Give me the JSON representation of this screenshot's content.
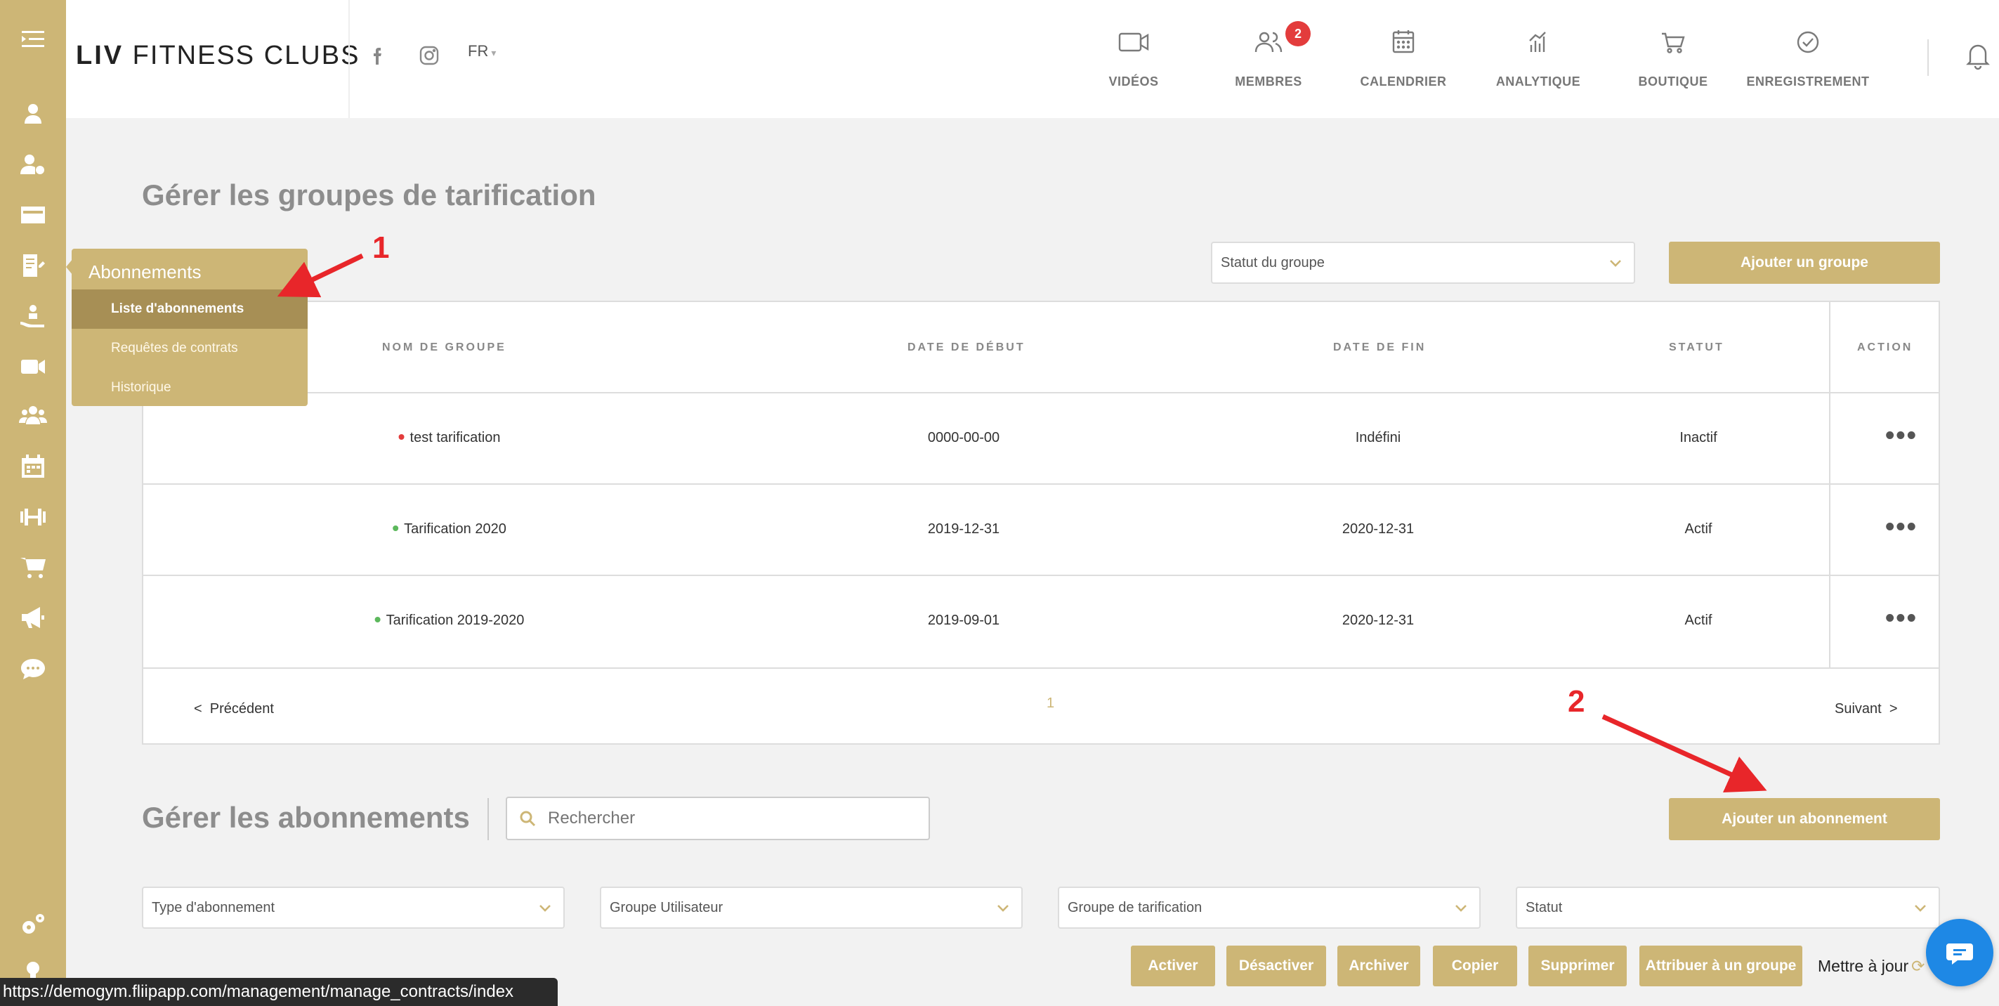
{
  "brand": {
    "logo_bold": "LIV",
    "logo_rest": " FITNESS CLUBS"
  },
  "header": {
    "language": "FR",
    "nav": [
      {
        "label": "VIDÉOS",
        "icon": "video-icon"
      },
      {
        "label": "MEMBRES",
        "icon": "members-icon",
        "badge": "2"
      },
      {
        "label": "CALENDRIER",
        "icon": "calendar-icon"
      },
      {
        "label": "ANALYTIQUE",
        "icon": "analytics-icon"
      },
      {
        "label": "BOUTIQUE",
        "icon": "cart-icon"
      },
      {
        "label": "ENREGISTREMENT",
        "icon": "check-circle-icon"
      }
    ]
  },
  "flyout": {
    "title": "Abonnements",
    "items": [
      "Liste d'abonnements",
      "Requêtes de contrats",
      "Historique"
    ]
  },
  "pricing": {
    "title": "Gérer les groupes de tarification",
    "status_select": "Statut du groupe",
    "add_button": "Ajouter un groupe",
    "columns": [
      "NOM DE GROUPE",
      "DATE DE DÉBUT",
      "DATE DE FIN",
      "STATUT",
      "ACTION"
    ],
    "rows": [
      {
        "name": "test tarification",
        "start": "0000-00-00",
        "end": "Indéfini",
        "status": "Inactif",
        "dot": "#e33c3c"
      },
      {
        "name": "Tarification 2020",
        "start": "2019-12-31",
        "end": "2020-12-31",
        "status": "Actif",
        "dot": "#5cb85c"
      },
      {
        "name": "Tarification 2019-2020",
        "start": "2019-09-01",
        "end": "2020-12-31",
        "status": "Actif",
        "dot": "#5cb85c"
      }
    ],
    "more": "•••",
    "pager": {
      "prev": "<  Précédent",
      "page": "1",
      "next": "Suivant  >"
    }
  },
  "subscriptions": {
    "title": "Gérer les abonnements",
    "search_placeholder": "Rechercher",
    "add_button": "Ajouter un abonnement",
    "filters": [
      "Type d'abonnement",
      "Groupe Utilisateur",
      "Groupe de tarification",
      "Statut"
    ],
    "actions": [
      "Activer",
      "Désactiver",
      "Archiver",
      "Copier",
      "Supprimer",
      "Attribuer à un groupe"
    ],
    "refresh": "Mettre à jour"
  },
  "annotations": {
    "one": "1",
    "two": "2"
  },
  "statusbar": "https://demogym.fliipapp.com/management/manage_contracts/index",
  "colors": {
    "gold": "#cdb676",
    "gold_dark": "#a78f55",
    "red": "#e8262a"
  }
}
